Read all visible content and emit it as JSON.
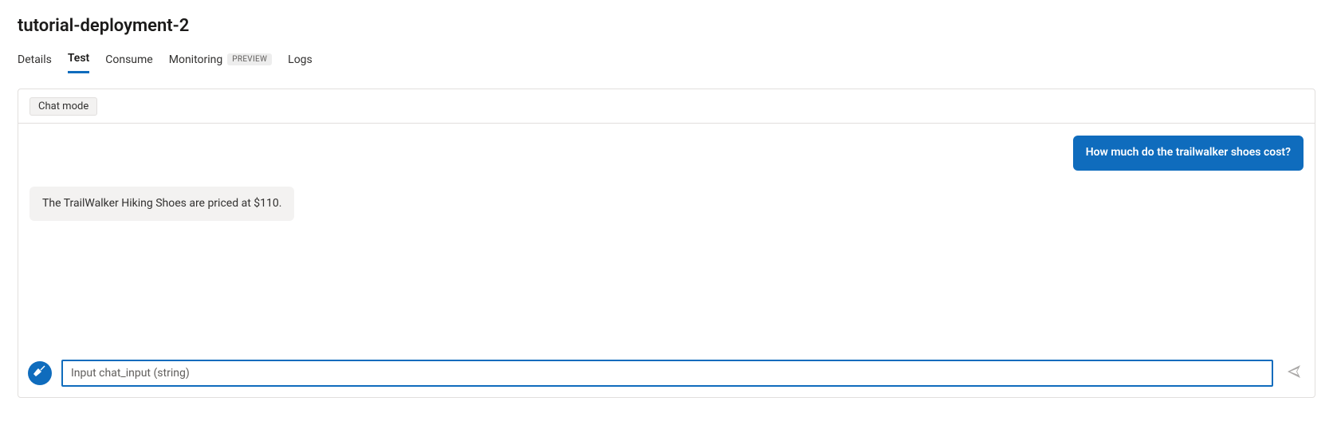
{
  "header": {
    "title": "tutorial-deployment-2"
  },
  "tabs": {
    "items": [
      {
        "label": "Details",
        "active": false,
        "badge": null
      },
      {
        "label": "Test",
        "active": true,
        "badge": null
      },
      {
        "label": "Consume",
        "active": false,
        "badge": null
      },
      {
        "label": "Monitoring",
        "active": false,
        "badge": "PREVIEW"
      },
      {
        "label": "Logs",
        "active": false,
        "badge": null
      }
    ]
  },
  "chat": {
    "mode_label": "Chat mode",
    "messages": [
      {
        "role": "user",
        "text": "How much do the trailwalker shoes cost?"
      },
      {
        "role": "bot",
        "text": "The TrailWalker Hiking Shoes are priced at $110."
      }
    ],
    "input": {
      "value": "",
      "placeholder": "Input chat_input (string)"
    },
    "icons": {
      "clear": "broom-icon",
      "send": "send-icon"
    }
  }
}
